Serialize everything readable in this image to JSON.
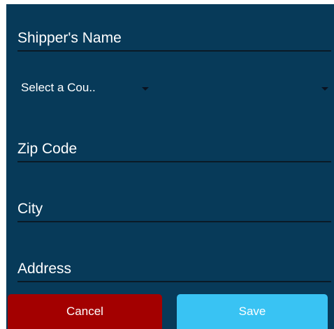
{
  "form": {
    "shipper_name_placeholder": "Shipper's Name",
    "country_select_value": "Select a Cou..",
    "zip_code_placeholder": "Zip Code",
    "city_placeholder": "City",
    "address_placeholder": "Address"
  },
  "actions": {
    "cancel_label": "Cancel",
    "save_label": "Save"
  },
  "colors": {
    "panel_background": "#073a59",
    "cancel_button": "#a30000",
    "save_button": "#39c3f3",
    "text": "#ffffff"
  },
  "icons": {
    "country_dropdown_caret": "chevron-down-icon",
    "country_dropdown_arrow": "chevron-down-icon"
  }
}
